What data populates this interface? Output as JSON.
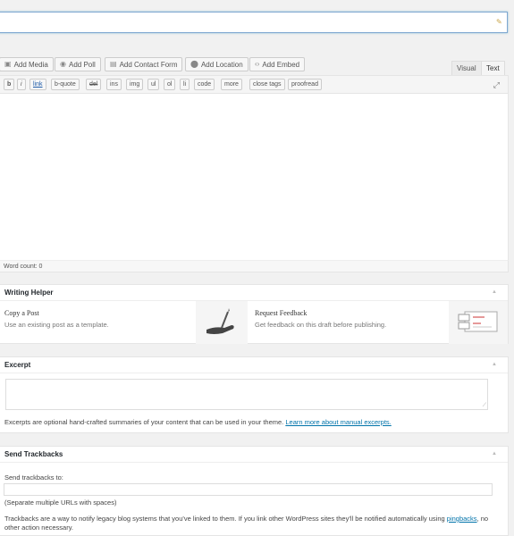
{
  "media_buttons": {
    "add_media": "Add Media",
    "add_poll": "Add Poll",
    "add_contact_form": "Add Contact Form",
    "add_location": "Add Location",
    "add_embed": "Add Embed"
  },
  "editor_tabs": {
    "visual": "Visual",
    "text": "Text"
  },
  "quicktags": [
    "b",
    "i",
    "link",
    "b-quote",
    "del",
    "ins",
    "img",
    "ul",
    "ol",
    "li",
    "code",
    "more",
    "close tags",
    "proofread"
  ],
  "word_count": "Word count: 0",
  "writing_helper": {
    "title": "Writing Helper",
    "copy_title": "Copy a Post",
    "copy_desc": "Use an existing post as a template.",
    "feedback_title": "Request Feedback",
    "feedback_desc": "Get feedback on this draft before publishing."
  },
  "excerpt": {
    "title": "Excerpt",
    "note": "Excerpts are optional hand-crafted summaries of your content that can be used in your theme.",
    "link": "Learn more about manual excerpts."
  },
  "trackbacks": {
    "title": "Send Trackbacks",
    "label": "Send trackbacks to:",
    "hint": "(Separate multiple URLs with spaces)",
    "note": "Trackbacks are a way to notify legacy blog systems that you've linked to them. If you link other WordPress sites they'll be notified automatically using",
    "link": "pingbacks",
    "note_end": ", no other action necessary."
  },
  "colors": {
    "link": "#0073aa",
    "focus_border": "#7fa8d1"
  }
}
